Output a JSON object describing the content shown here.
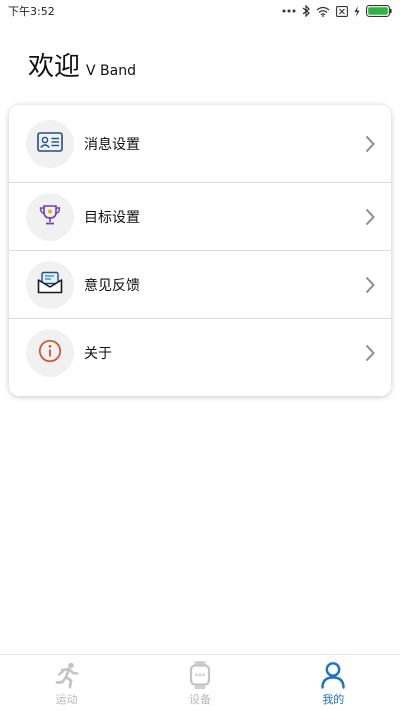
{
  "status_bar": {
    "time": "下午3:52"
  },
  "header": {
    "greeting": "欢迎",
    "username": "V Band"
  },
  "settings": {
    "items": [
      {
        "label": "消息设置",
        "icon": "id-card-icon"
      },
      {
        "label": "目标设置",
        "icon": "trophy-icon"
      },
      {
        "label": "意见反馈",
        "icon": "envelope-icon"
      },
      {
        "label": "关于",
        "icon": "info-icon"
      }
    ]
  },
  "bottom_nav": {
    "items": [
      {
        "label": "运动",
        "icon": "running-icon",
        "active": false
      },
      {
        "label": "设备",
        "icon": "watch-icon",
        "active": false
      },
      {
        "label": "我的",
        "icon": "person-icon",
        "active": true
      }
    ]
  },
  "colors": {
    "accent": "#1a73c9",
    "inactive": "#b9b9b9",
    "info_red": "#d0502a",
    "trophy_purple": "#6a3fc2"
  }
}
